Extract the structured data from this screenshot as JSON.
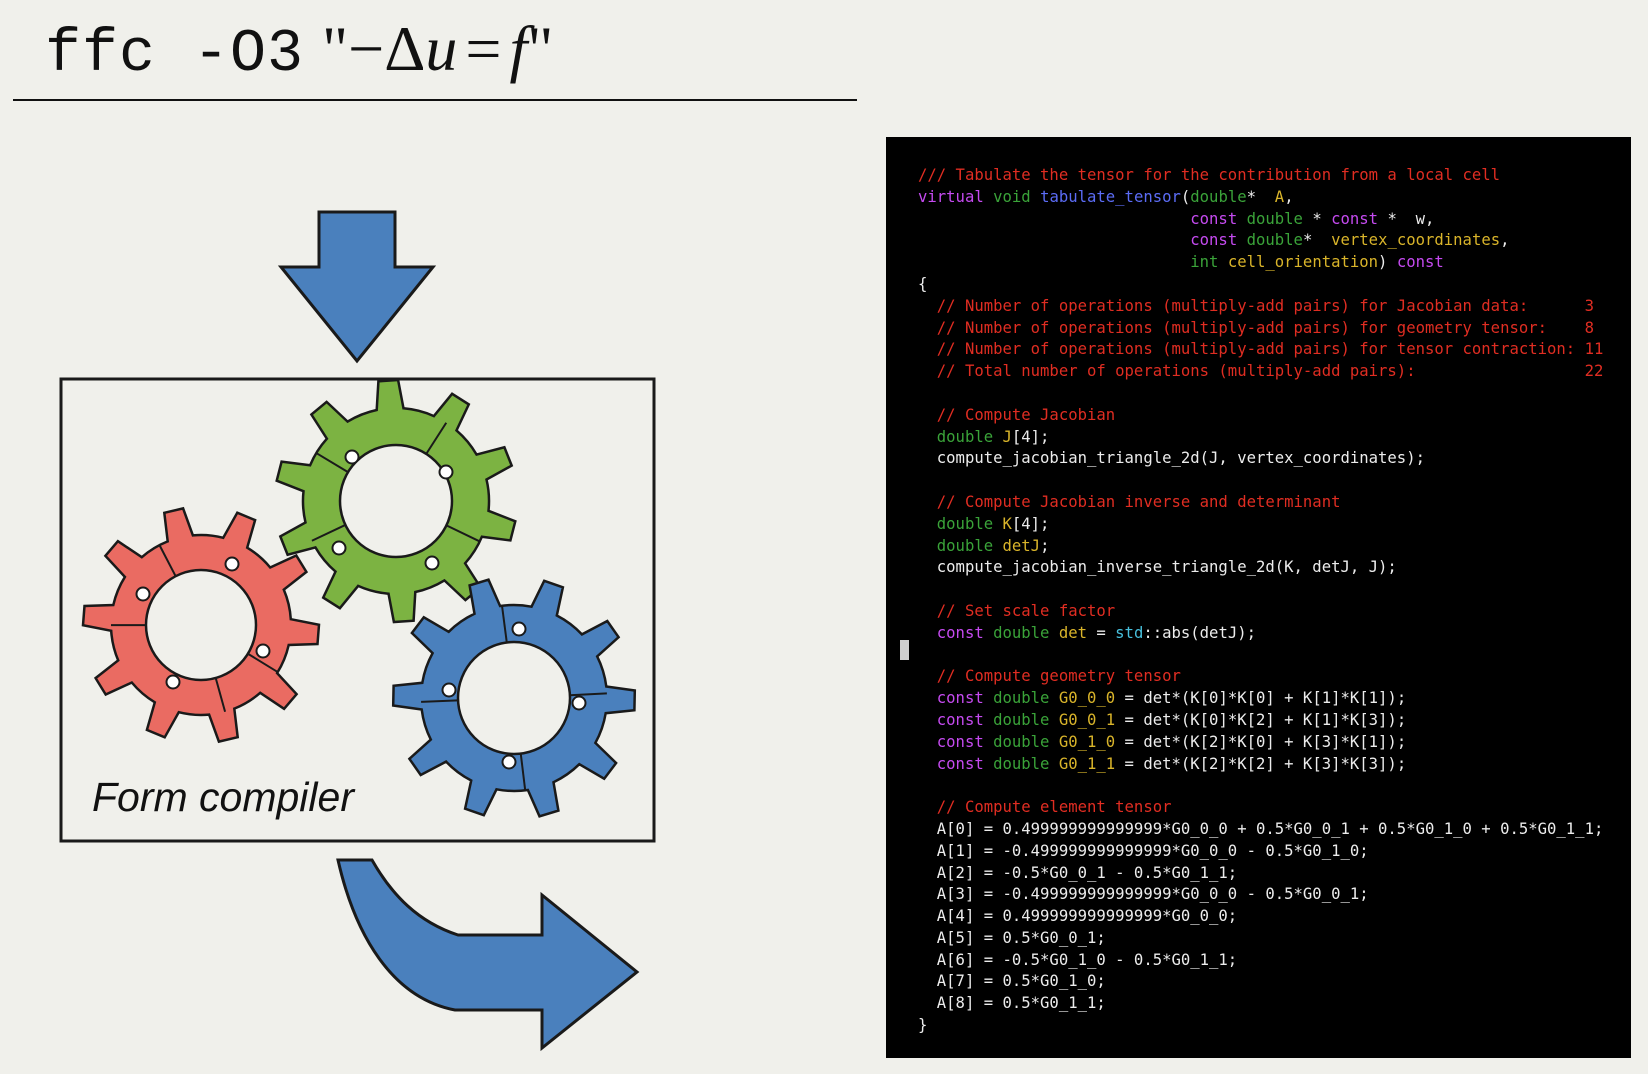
{
  "title": {
    "command": "ffc -O3",
    "open_quote": "\"",
    "minus": "−",
    "delta": "Δ",
    "u": "u",
    "equals": "=",
    "f": "f",
    "close_quote": "\""
  },
  "diagram": {
    "box_label": "Form compiler",
    "gear_colors": {
      "red": "#ea6b62",
      "green": "#7cb342",
      "blue": "#4a80bd"
    },
    "arrow_color": "#4a80bd"
  },
  "code": {
    "colors": {
      "comment": "#e02d22",
      "keyword": "#c54af0",
      "type": "#3aa339",
      "function": "#5b6cf5",
      "variable": "#d9b42a",
      "namespace": "#48c0dd",
      "text": "#ececec"
    },
    "lines": [
      [
        [
          "cm",
          "/// Tabulate the tensor for the contribution from a local cell"
        ]
      ],
      [
        [
          "kw",
          "virtual "
        ],
        [
          "ty",
          "void "
        ],
        [
          "fn",
          "tabulate_tensor"
        ],
        [
          "tx",
          "("
        ],
        [
          "ty",
          "double"
        ],
        [
          "tx",
          "*  "
        ],
        [
          "va",
          "A"
        ],
        [
          "tx",
          ","
        ]
      ],
      [
        [
          "tx",
          "                             "
        ],
        [
          "kw",
          "const "
        ],
        [
          "ty",
          "double"
        ],
        [
          "tx",
          " * "
        ],
        [
          "kw",
          "const"
        ],
        [
          "tx",
          " *  w,"
        ]
      ],
      [
        [
          "tx",
          "                             "
        ],
        [
          "kw",
          "const "
        ],
        [
          "ty",
          "double"
        ],
        [
          "tx",
          "*  "
        ],
        [
          "va",
          "vertex_coordinates"
        ],
        [
          "tx",
          ","
        ]
      ],
      [
        [
          "tx",
          "                             "
        ],
        [
          "ty",
          "int "
        ],
        [
          "va",
          "cell_orientation"
        ],
        [
          "tx",
          ") "
        ],
        [
          "kw",
          "const"
        ]
      ],
      [
        [
          "tx",
          "{"
        ]
      ],
      [
        [
          "cm",
          "  // Number of operations (multiply-add pairs) for Jacobian data:      3"
        ]
      ],
      [
        [
          "cm",
          "  // Number of operations (multiply-add pairs) for geometry tensor:    8"
        ]
      ],
      [
        [
          "cm",
          "  // Number of operations (multiply-add pairs) for tensor contraction: 11"
        ]
      ],
      [
        [
          "cm",
          "  // Total number of operations (multiply-add pairs):                  22"
        ]
      ],
      [
        [
          "tx",
          ""
        ]
      ],
      [
        [
          "cm",
          "  // Compute Jacobian"
        ]
      ],
      [
        [
          "ty",
          "  double "
        ],
        [
          "va",
          "J"
        ],
        [
          "tx",
          "[4];"
        ]
      ],
      [
        [
          "tx",
          "  compute_jacobian_triangle_2d(J, vertex_coordinates);"
        ]
      ],
      [
        [
          "tx",
          ""
        ]
      ],
      [
        [
          "cm",
          "  // Compute Jacobian inverse and determinant"
        ]
      ],
      [
        [
          "ty",
          "  double "
        ],
        [
          "va",
          "K"
        ],
        [
          "tx",
          "[4];"
        ]
      ],
      [
        [
          "ty",
          "  double "
        ],
        [
          "va",
          "detJ"
        ],
        [
          "tx",
          ";"
        ]
      ],
      [
        [
          "tx",
          "  compute_jacobian_inverse_triangle_2d(K, detJ, J);"
        ]
      ],
      [
        [
          "tx",
          ""
        ]
      ],
      [
        [
          "cm",
          "  // Set scale factor"
        ]
      ],
      [
        [
          "kw",
          "  const "
        ],
        [
          "ty",
          "double "
        ],
        [
          "va",
          "det"
        ],
        [
          "tx",
          " = "
        ],
        [
          "ns",
          "std"
        ],
        [
          "tx",
          "::abs(detJ);"
        ]
      ],
      [
        [
          "tx",
          ""
        ]
      ],
      [
        [
          "cm",
          "  // Compute geometry tensor"
        ]
      ],
      [
        [
          "kw",
          "  const "
        ],
        [
          "ty",
          "double "
        ],
        [
          "va",
          "G0_0_0"
        ],
        [
          "tx",
          " = det*(K[0]*K[0] + K[1]*K[1]);"
        ]
      ],
      [
        [
          "kw",
          "  const "
        ],
        [
          "ty",
          "double "
        ],
        [
          "va",
          "G0_0_1"
        ],
        [
          "tx",
          " = det*(K[0]*K[2] + K[1]*K[3]);"
        ]
      ],
      [
        [
          "kw",
          "  const "
        ],
        [
          "ty",
          "double "
        ],
        [
          "va",
          "G0_1_0"
        ],
        [
          "tx",
          " = det*(K[2]*K[0] + K[3]*K[1]);"
        ]
      ],
      [
        [
          "kw",
          "  const "
        ],
        [
          "ty",
          "double "
        ],
        [
          "va",
          "G0_1_1"
        ],
        [
          "tx",
          " = det*(K[2]*K[2] + K[3]*K[3]);"
        ]
      ],
      [
        [
          "tx",
          ""
        ]
      ],
      [
        [
          "cm",
          "  // Compute element tensor"
        ]
      ],
      [
        [
          "tx",
          "  A[0] = 0.499999999999999*G0_0_0 + 0.5*G0_0_1 + 0.5*G0_1_0 + 0.5*G0_1_1;"
        ]
      ],
      [
        [
          "tx",
          "  A[1] = -0.499999999999999*G0_0_0 - 0.5*G0_1_0;"
        ]
      ],
      [
        [
          "tx",
          "  A[2] = -0.5*G0_0_1 - 0.5*G0_1_1;"
        ]
      ],
      [
        [
          "tx",
          "  A[3] = -0.499999999999999*G0_0_0 - 0.5*G0_0_1;"
        ]
      ],
      [
        [
          "tx",
          "  A[4] = 0.499999999999999*G0_0_0;"
        ]
      ],
      [
        [
          "tx",
          "  A[5] = 0.5*G0_0_1;"
        ]
      ],
      [
        [
          "tx",
          "  A[6] = -0.5*G0_1_0 - 0.5*G0_1_1;"
        ]
      ],
      [
        [
          "tx",
          "  A[7] = 0.5*G0_1_0;"
        ]
      ],
      [
        [
          "tx",
          "  A[8] = 0.5*G0_1_1;"
        ]
      ],
      [
        [
          "tx",
          "}"
        ]
      ]
    ]
  }
}
